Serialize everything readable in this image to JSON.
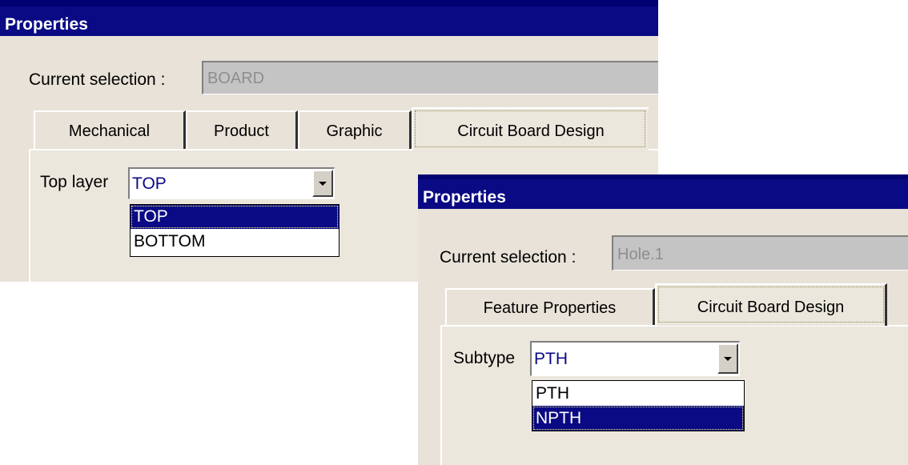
{
  "window1": {
    "title": "Properties",
    "current_selection_label": "Current selection :",
    "current_selection_value": "BOARD",
    "tabs": [
      {
        "label": "Mechanical",
        "active": false
      },
      {
        "label": "Product",
        "active": false
      },
      {
        "label": "Graphic",
        "active": false
      },
      {
        "label": "Circuit Board Design",
        "active": true
      }
    ],
    "field_label": "Top layer",
    "field_value": "TOP",
    "options": [
      {
        "label": "TOP",
        "highlighted": true
      },
      {
        "label": "BOTTOM",
        "highlighted": false
      }
    ]
  },
  "window2": {
    "title": "Properties",
    "current_selection_label": "Current selection :",
    "current_selection_value": "Hole.1",
    "tabs": [
      {
        "label": "Feature Properties",
        "active": false
      },
      {
        "label": "Circuit Board Design",
        "active": true
      }
    ],
    "field_label": "Subtype",
    "field_value": "PTH",
    "options": [
      {
        "label": "PTH",
        "highlighted": false
      },
      {
        "label": "NPTH",
        "highlighted": true
      }
    ]
  },
  "colors": {
    "titlebar": "#0a0a84",
    "dialog_bg": "#e8e2d8",
    "highlight": "#0a0a84",
    "value_text": "#0a0a84"
  },
  "icons": {
    "dropdown_button": "chevron-down-icon"
  }
}
